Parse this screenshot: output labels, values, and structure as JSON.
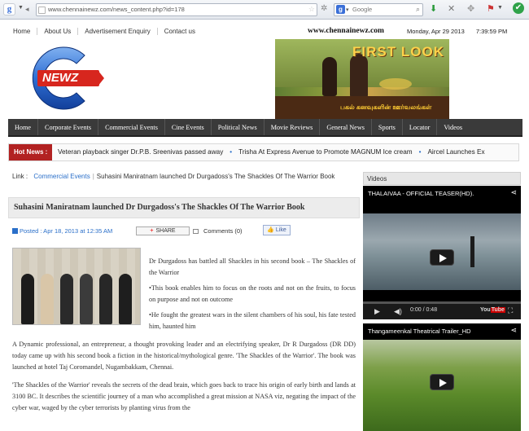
{
  "browser": {
    "url": "www.chennainewz.com/news_content.php?id=178",
    "search_placeholder": "Google",
    "search_engine": "g"
  },
  "site": {
    "top_nav": [
      "Home",
      "About Us",
      "Advertisement Enquiry",
      "Contact us"
    ],
    "domain": "www.chennainewz.com",
    "date": "Monday, Apr 29 2013",
    "time": "7:39:59 PM",
    "logo_text": "NEWZ",
    "banner_text": "FIRST LOOK",
    "banner_subtext": "பகல் கனவுகளின் ஊர்வலங்கள்"
  },
  "main_nav": [
    "Home",
    "Corporate Events",
    "Commercial Events",
    "Cine Events",
    "Political News",
    "Movie Reviews",
    "General News",
    "Sports",
    "Locator",
    "Videos"
  ],
  "ticker": {
    "label": "Hot News :",
    "items": [
      "Veteran playback singer Dr.P.B. Sreenivas passed away",
      "Trisha At Express Avenue to Promote MAGNUM Ice cream",
      "Aircel Launches Ex"
    ]
  },
  "breadcrumb": {
    "label": "Link :",
    "category": "Commercial Events",
    "current": "Suhasini Maniratnam launched Dr Durgadoss's The Shackles Of The Warrior Book"
  },
  "article": {
    "title": "Suhasini Maniratnam launched Dr Durgadoss's The Shackles Of The Warrior Book",
    "posted": "Posted : Apr 18, 2013 at 12:35 AM",
    "share_label": "SHARE",
    "comments": "Comments (0)",
    "like_label": "Like",
    "paragraphs": [
      "Dr Durgadoss has battled all Shackles in his second book – The Shackles of the Warrior",
      "•This book enables him to focus on the roots and not on the fruits, to focus on purpose and not on outcome",
      "•He fought the greatest wars in the silent chambers of his soul, his fate tested him, haunted him",
      "A Dynamic professional, an entrepreneur, a thought provoking leader and an electrifying speaker, Dr R Durgadoss (DR DD) today came up with his second book a fiction in the historical/mythological genre. 'The Shackles of the Warrior'. The book was launched at hotel Taj Coromandel, Nugambakkam, Chennai.",
      "'The Shackles of the Warrior' reveals the secrets of the dead brain, which goes back to trace his origin of early birth and lands at 3100 BC. It describes the scientific journey of a man who accomplished a great mission at NASA viz, negating the impact of the cyber war, waged by the cyber terrorists by planting virus from the"
    ]
  },
  "videos": {
    "heading": "Videos",
    "items": [
      {
        "title": "THALAIVAA - OFFICIAL TEASER(HD).",
        "time": "0:00 / 0:48",
        "progress": 0.0
      },
      {
        "title": "Thangameenkal Theatrical Trailer_HD"
      }
    ]
  }
}
